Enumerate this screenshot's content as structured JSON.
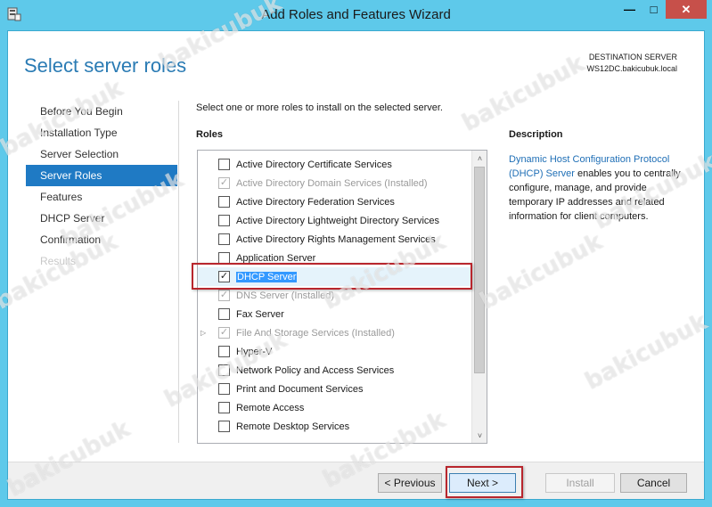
{
  "window": {
    "title": "Add Roles and Features Wizard",
    "min_glyph": "—",
    "max_glyph": "□",
    "close_glyph": "✕"
  },
  "page": {
    "heading": "Select server roles",
    "destination_label": "DESTINATION SERVER",
    "destination_value": "WS12DC.bakicubuk.local",
    "intro": "Select one or more roles to install on the selected server."
  },
  "nav": {
    "items": [
      {
        "label": "Before You Begin",
        "state": "normal"
      },
      {
        "label": "Installation Type",
        "state": "normal"
      },
      {
        "label": "Server Selection",
        "state": "normal"
      },
      {
        "label": "Server Roles",
        "state": "active"
      },
      {
        "label": "Features",
        "state": "normal"
      },
      {
        "label": "DHCP Server",
        "state": "normal"
      },
      {
        "label": "Confirmation",
        "state": "normal"
      },
      {
        "label": "Results",
        "state": "disabled"
      }
    ]
  },
  "roles": {
    "header": "Roles",
    "items": [
      {
        "label": "Active Directory Certificate Services",
        "checked": false,
        "disabled": false
      },
      {
        "label": "Active Directory Domain Services (Installed)",
        "checked": true,
        "disabled": true
      },
      {
        "label": "Active Directory Federation Services",
        "checked": false,
        "disabled": false
      },
      {
        "label": "Active Directory Lightweight Directory Services",
        "checked": false,
        "disabled": false
      },
      {
        "label": "Active Directory Rights Management Services",
        "checked": false,
        "disabled": false
      },
      {
        "label": "Application Server",
        "checked": false,
        "disabled": false
      },
      {
        "label": "DHCP Server",
        "checked": true,
        "disabled": false,
        "selected": true
      },
      {
        "label": "DNS Server (Installed)",
        "checked": true,
        "disabled": true
      },
      {
        "label": "Fax Server",
        "checked": false,
        "disabled": false
      },
      {
        "label": "File And Storage Services (Installed)",
        "checked": true,
        "disabled": true,
        "expandable": true
      },
      {
        "label": "Hyper-V",
        "checked": false,
        "disabled": false
      },
      {
        "label": "Network Policy and Access Services",
        "checked": false,
        "disabled": false
      },
      {
        "label": "Print and Document Services",
        "checked": false,
        "disabled": false
      },
      {
        "label": "Remote Access",
        "checked": false,
        "disabled": false
      },
      {
        "label": "Remote Desktop Services",
        "checked": false,
        "disabled": false
      }
    ],
    "scroll_up_glyph": "˄",
    "scroll_down_glyph": "˅",
    "grip_glyph": "≡"
  },
  "description": {
    "header": "Description",
    "link_text": "Dynamic Host Configuration Protocol (DHCP) Server",
    "text": " enables you to centrally configure, manage, and provide temporary IP addresses and related information for client computers."
  },
  "buttons": {
    "previous": "< Previous",
    "next": "Next >",
    "install": "Install",
    "cancel": "Cancel"
  },
  "watermark": "bakicubuk",
  "colors": {
    "titlebar": "#5ec9ea",
    "accent": "#1f7ac4",
    "heading": "#2a7bb4",
    "link": "#1f6fb6",
    "annotation": "#b8262d",
    "selection": "#3399ff"
  }
}
